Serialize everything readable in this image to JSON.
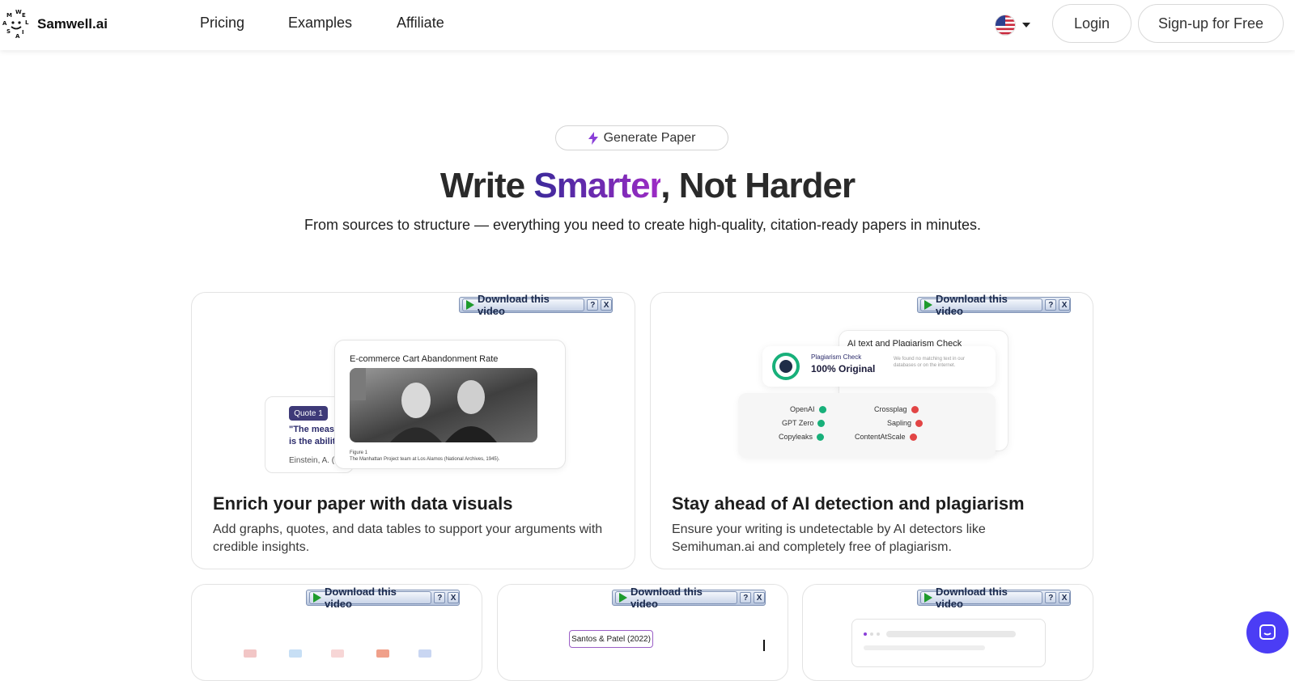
{
  "nav": {
    "logo_text": "Samwell.ai",
    "links": [
      "Pricing",
      "Examples",
      "Affiliate"
    ],
    "language_flag": "us-flag-icon",
    "login": "Login",
    "signup": "Sign-up for Free"
  },
  "hero": {
    "pill": "Generate Paper",
    "headline_pre": "Write ",
    "headline_accent": "Smarter",
    "headline_post": ", Not Harder",
    "subtitle": "From sources to structure — everything you need to create high-quality, citation-ready papers in minutes."
  },
  "download_bar": {
    "label": "Download this video",
    "help": "?",
    "close": "X"
  },
  "cards": [
    {
      "title": "Enrich your paper with data visuals",
      "description": "Add graphs, quotes, and data tables to support your arguments with credible insights.",
      "visual": {
        "figure_title": "E-commerce Cart Abandonment Rate",
        "figure_caption_1": "Figure 1",
        "figure_caption_2": "The Manhattan Project team at Los Alamos (National Archives, 1945).",
        "quote_tag": "Quote 1",
        "quote_text_1": "\"The meas",
        "quote_text_2": "is the abilit",
        "quote_author": "Einstein, A. ("
      }
    },
    {
      "title": "Stay ahead of AI detection and plagiarism",
      "description": "Ensure your writing is undetectable by AI detectors like Semihuman.ai and completely free of plagiarism.",
      "visual": {
        "panel_title": "AI text and Plagiarism Check",
        "check_label": "Plagiarism Check",
        "check_value": "100% Original",
        "check_note": "We found no matching text in our databases or on the internet.",
        "passed": [
          "OpenAI",
          "GPT Zero",
          "Copyleaks"
        ],
        "failed": [
          "Crossplag",
          "Sapling",
          "ContentAtScale"
        ]
      }
    }
  ],
  "bottom_cards": {
    "citation": "Santos & Patel (2022)"
  },
  "colors": {
    "accent_start": "#3b2a9a",
    "accent_end": "#9d2bc5",
    "chat_button": "#4b3df5"
  }
}
